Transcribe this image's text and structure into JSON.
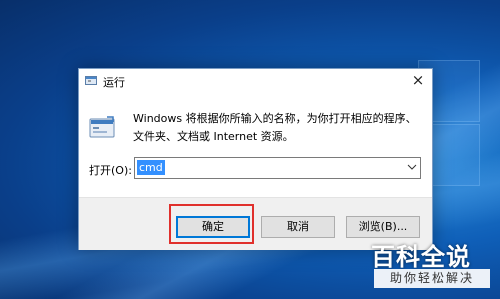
{
  "dialog": {
    "title": "运行",
    "close_label": "×",
    "description": "Windows 将根据你所输入的名称，为你打开相应的程序、文件夹、文档或 Internet 资源。",
    "open_label": "打开(O):",
    "open_value": "cmd",
    "buttons": {
      "ok": "确定",
      "cancel": "取消",
      "browse": "浏览(B)..."
    }
  },
  "watermark": {
    "title": "百科全说",
    "subtitle": "助你轻松解决"
  },
  "colors": {
    "highlight": "#e0302c",
    "selection": "#3390ff",
    "focus_border": "#0078d7"
  },
  "icons": [
    "run-icon",
    "run-large-icon",
    "close-icon",
    "chevron-down-icon"
  ]
}
